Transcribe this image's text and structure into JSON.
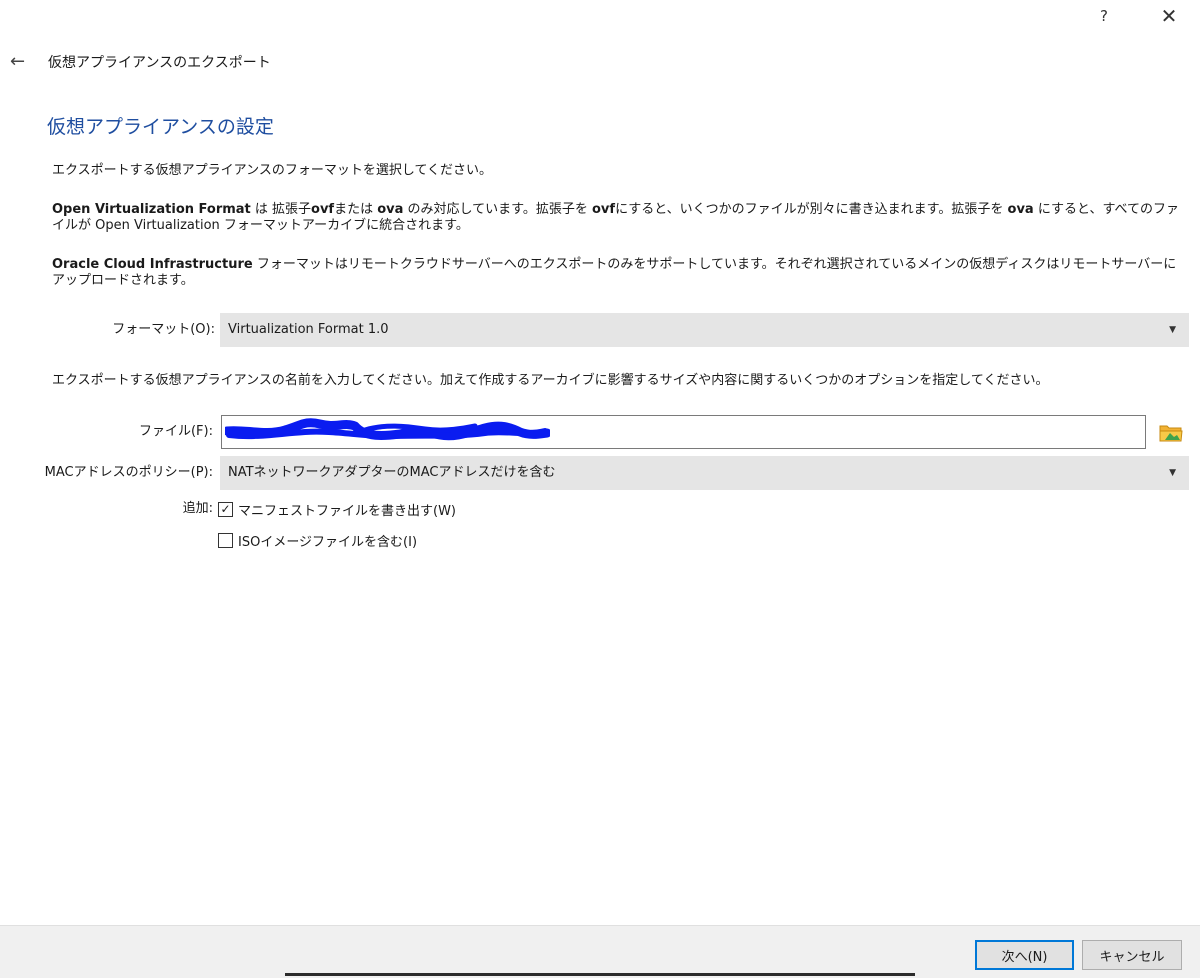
{
  "titlebar": {
    "help": "?",
    "close": "✕"
  },
  "header": {
    "back": "←",
    "window_title": "仮想アプライアンスのエクスポート"
  },
  "page_title": "仮想アプライアンスの設定",
  "intro_text": "エクスポートする仮想アプライアンスのフォーマットを選択してください。",
  "ovf_text": {
    "bold1": "Open Virtualization Format",
    "t1": " は 拡張子",
    "bold2": "ovf",
    "t2": "または ",
    "bold3": "ova",
    "t3": " のみ対応しています。拡張子を ",
    "bold4": "ovf",
    "t4": "にすると、いくつかのファイルが別々に書き込まれます。拡張子を ",
    "bold5": "ova",
    "t5": " にすると、すべてのファイルが Open Virtualization フォーマットアーカイブに統合されます。"
  },
  "oci_text": {
    "bold1": "Oracle Cloud Infrastructure",
    "t1": " フォーマットはリモートクラウドサーバーへのエクスポートのみをサポートしています。それぞれ選択されているメインの仮想ディスクはリモートサーバーにアップロードされます。"
  },
  "format": {
    "label": "フォーマット(O):",
    "value": "Virtualization Format 1.0"
  },
  "name_text": "エクスポートする仮想アプライアンスの名前を入力してください。加えて作成するアーカイブに影響するサイズや内容に関するいくつかのオプションを指定してください。",
  "file": {
    "label": "ファイル(F):",
    "value": ""
  },
  "mac_policy": {
    "label": "MACアドレスのポリシー(P):",
    "value": "NATネットワークアダプターのMACアドレスだけを含む"
  },
  "additional": {
    "label": "追加:",
    "manifest_label": "マニフェストファイルを書き出す(W)",
    "manifest_checked": true,
    "iso_label": "ISOイメージファイルを含む(I)",
    "iso_checked": false
  },
  "footer": {
    "next_label": "次へ(N)",
    "cancel_label": "キャンセル"
  },
  "colors": {
    "title_blue": "#1f4ea0",
    "focus_blue": "#0078d7",
    "scribble_blue": "#0a1cf0"
  }
}
